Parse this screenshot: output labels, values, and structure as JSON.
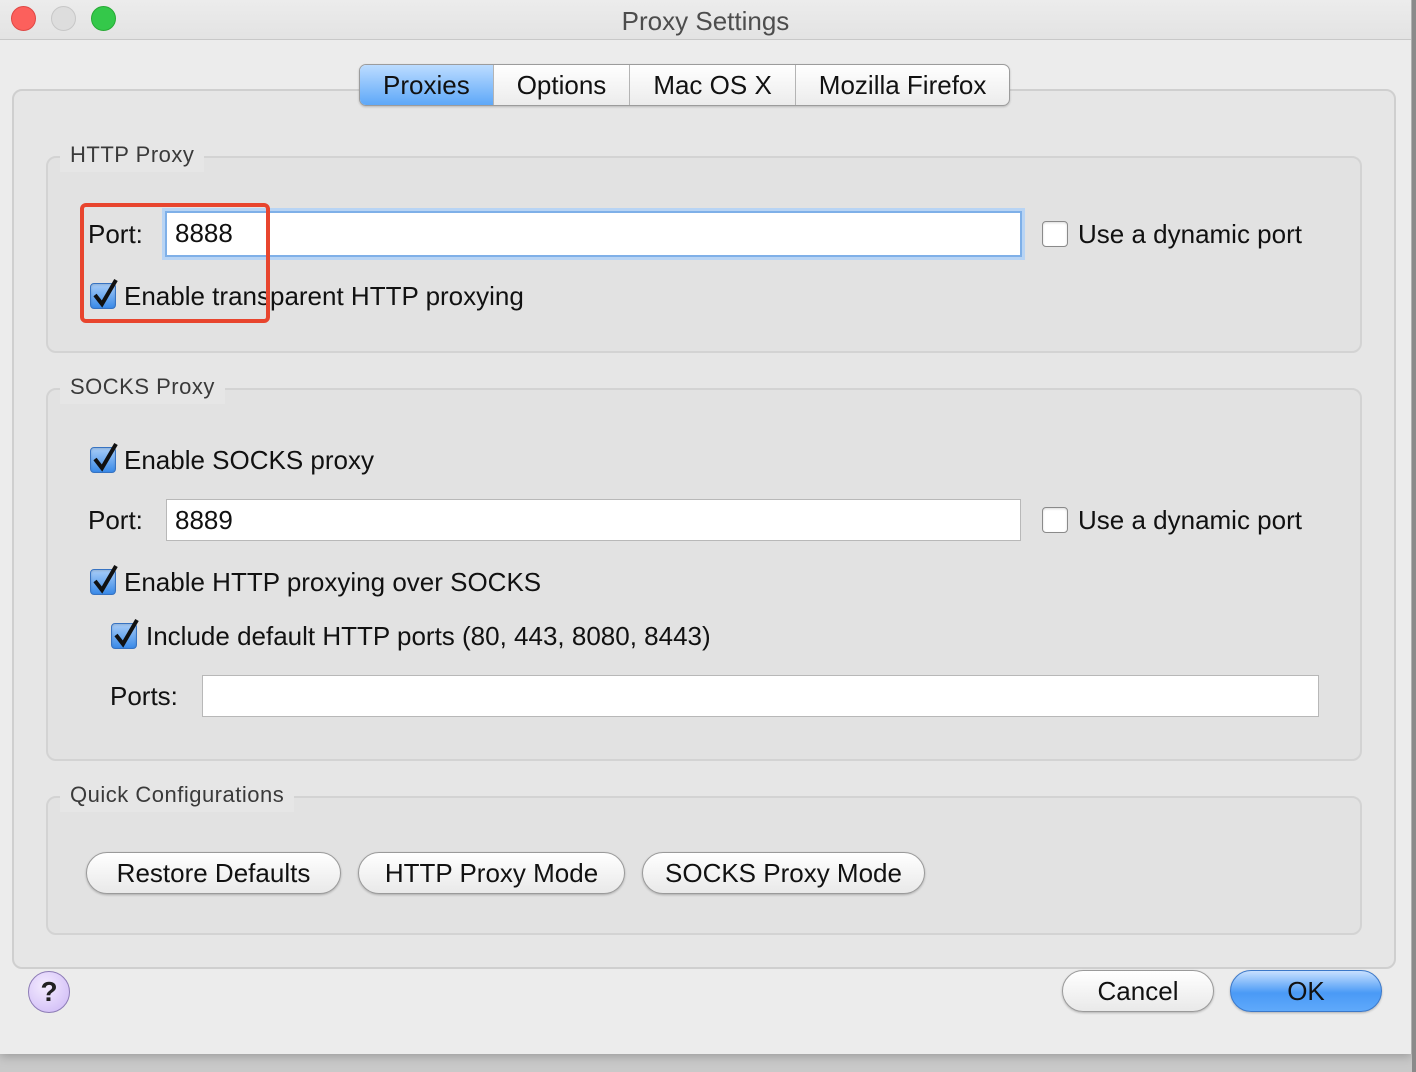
{
  "window": {
    "title": "Proxy Settings"
  },
  "tabs": [
    {
      "label": "Proxies",
      "active": true
    },
    {
      "label": "Options",
      "active": false
    },
    {
      "label": "Mac OS X",
      "active": false
    },
    {
      "label": "Mozilla Firefox",
      "active": false
    }
  ],
  "http_proxy": {
    "title": "HTTP Proxy",
    "port_label": "Port:",
    "port_value": "8888",
    "dynamic_port_label": "Use a dynamic port",
    "dynamic_port_checked": false,
    "transparent_label": "Enable transparent HTTP proxying",
    "transparent_checked": true
  },
  "socks_proxy": {
    "title": "SOCKS Proxy",
    "enable_label": "Enable SOCKS proxy",
    "enable_checked": true,
    "port_label": "Port:",
    "port_value": "8889",
    "dynamic_port_label": "Use a dynamic port",
    "dynamic_port_checked": false,
    "http_over_socks_label": "Enable HTTP proxying over SOCKS",
    "http_over_socks_checked": true,
    "include_default_label": "Include default HTTP ports (80, 443, 8080, 8443)",
    "include_default_checked": true,
    "ports_label": "Ports:",
    "ports_value": ""
  },
  "quick_config": {
    "title": "Quick Configurations",
    "restore_label": "Restore Defaults",
    "http_mode_label": "HTTP Proxy Mode",
    "socks_mode_label": "SOCKS Proxy Mode"
  },
  "footer": {
    "help_label": "?",
    "cancel_label": "Cancel",
    "ok_label": "OK"
  },
  "colors": {
    "accent": "#5ea8f8",
    "highlight": "#e8452e"
  }
}
